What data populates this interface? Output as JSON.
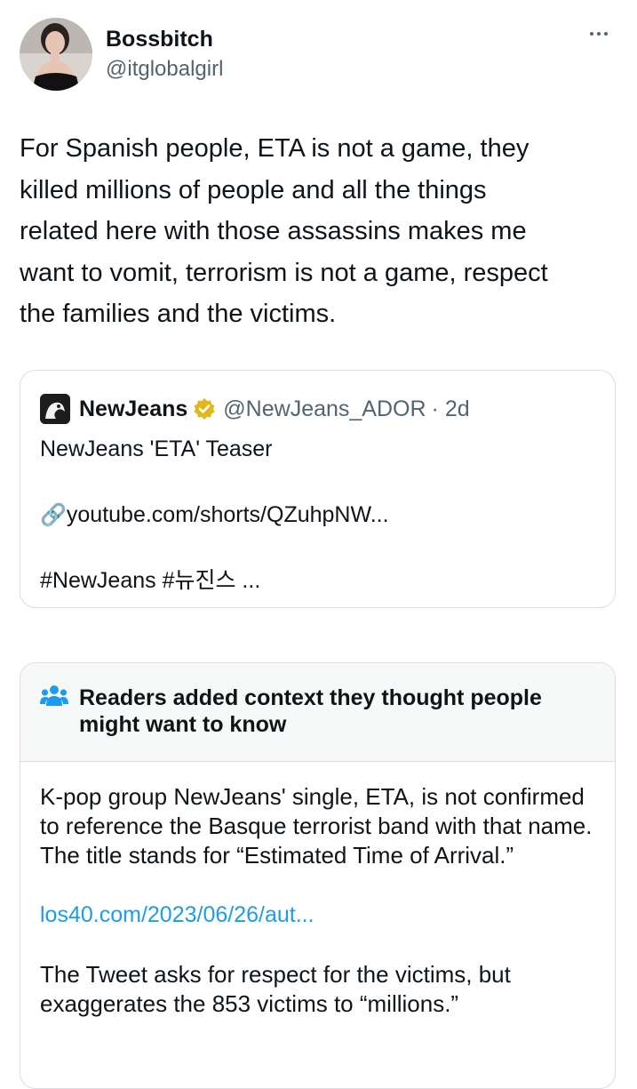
{
  "author": {
    "display_name": "Bossbitch",
    "handle": "@itglobalgirl"
  },
  "tweet": {
    "text": "For Spanish people, ETA is not a game, they\nkilled millions of people and all the things\nrelated here with those assassins makes me\nwant to vomit, terrorism is not a game, respect\nthe families and the victims."
  },
  "quoted_tweet": {
    "name": "NewJeans",
    "handle": "@NewJeans_ADOR",
    "time": "· 2d",
    "line1": "NewJeans 'ETA' Teaser",
    "link_emoji": "🔗",
    "link": "youtube.com/shorts/QZuhpNW...",
    "hashtags": "#NewJeans #뉴진스 ...",
    "verified_color": "#e2b719"
  },
  "community_note": {
    "title": "Readers added context they thought people might want to know",
    "body1": "K-pop group NewJeans' single, ETA, is not confirmed to reference the Basque terrorist band with that name. The title stands for “Estimated Time of Arrival.”",
    "link": "los40.com/2023/06/26/aut...",
    "body2": "The Tweet asks for respect for the victims, but exaggerates the 853 victims to “millions.”",
    "icon_color": "#1d9bf0"
  },
  "colors": {
    "link": "#1d9bf0",
    "secondary_text": "#536471",
    "border": "#d8dee3"
  }
}
